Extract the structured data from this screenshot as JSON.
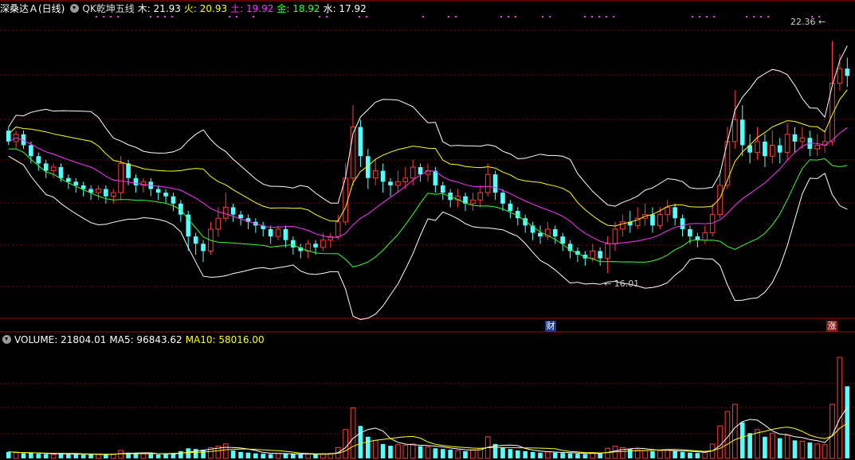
{
  "main_header": {
    "title": "深桑达Ａ(日线)",
    "indicator": "QK乾坤五线",
    "mu": "木: 21.93",
    "huo": "火: 20.93",
    "tu": "土: 19.92",
    "jin": "金: 18.92",
    "shui": "水: 17.92"
  },
  "volume_header": {
    "volume": "VOLUME: 21804.01",
    "ma5": "MA5: 96843.62",
    "ma10": "MA10: 58016.00"
  },
  "annotations": {
    "high_label": "22.36",
    "low_label": "16.01",
    "tag_cai": "财",
    "tag_zhang": "涨"
  },
  "colors": {
    "up": "#ff3b3b",
    "down": "#54ffff",
    "mu_line": "#ffffff",
    "huo_line": "#ffff00",
    "tu_line": "#ff33ff",
    "jin_line": "#33ff33",
    "shui_line": "#ffffff",
    "grid": "#8a0000"
  },
  "chart_data": {
    "type": "candlestick",
    "price_range": [
      14.8,
      23.0
    ],
    "volume_range": [
      0,
      300000
    ],
    "high": 22.36,
    "low": 16.01,
    "candles": [
      [
        19.9,
        19.6,
        20.0,
        19.5
      ],
      [
        19.6,
        19.8,
        19.9,
        19.4
      ],
      [
        19.8,
        19.5,
        19.9,
        19.4
      ],
      [
        19.5,
        19.2,
        19.6,
        19.0
      ],
      [
        19.2,
        19.0,
        19.3,
        18.8
      ],
      [
        19.0,
        18.8,
        19.1,
        18.6
      ],
      [
        18.8,
        18.9,
        19.0,
        18.6
      ],
      [
        18.9,
        18.6,
        19.0,
        18.5
      ],
      [
        18.6,
        18.5,
        18.7,
        18.3
      ],
      [
        18.5,
        18.4,
        18.6,
        18.2
      ],
      [
        18.4,
        18.3,
        18.5,
        18.1
      ],
      [
        18.3,
        18.2,
        18.4,
        18.0
      ],
      [
        18.2,
        18.3,
        18.4,
        18.0
      ],
      [
        18.3,
        18.1,
        18.4,
        17.9
      ],
      [
        18.1,
        18.2,
        18.3,
        17.9
      ],
      [
        18.2,
        19.0,
        19.2,
        18.0
      ],
      [
        19.0,
        18.6,
        19.1,
        18.4
      ],
      [
        18.6,
        18.4,
        18.7,
        18.2
      ],
      [
        18.4,
        18.5,
        18.6,
        18.2
      ],
      [
        18.5,
        18.3,
        18.6,
        18.1
      ],
      [
        18.3,
        18.2,
        18.4,
        18.0
      ],
      [
        18.2,
        18.1,
        18.3,
        17.9
      ],
      [
        18.1,
        17.9,
        18.2,
        17.7
      ],
      [
        17.9,
        17.6,
        18.0,
        17.4
      ],
      [
        17.6,
        17.0,
        17.7,
        16.6
      ],
      [
        17.0,
        16.8,
        17.1,
        16.5
      ],
      [
        16.8,
        16.6,
        16.9,
        16.3
      ],
      [
        16.6,
        17.2,
        17.4,
        16.5
      ],
      [
        17.2,
        17.5,
        17.8,
        17.0
      ],
      [
        17.5,
        17.8,
        18.2,
        17.4
      ],
      [
        17.8,
        17.6,
        17.9,
        17.4
      ],
      [
        17.6,
        17.5,
        17.7,
        17.3
      ],
      [
        17.5,
        17.4,
        17.6,
        17.2
      ],
      [
        17.4,
        17.3,
        17.5,
        17.1
      ],
      [
        17.3,
        17.2,
        17.4,
        17.0
      ],
      [
        17.2,
        17.0,
        17.3,
        16.8
      ],
      [
        17.0,
        17.2,
        17.3,
        16.9
      ],
      [
        17.2,
        16.9,
        17.3,
        16.7
      ],
      [
        16.9,
        16.7,
        17.0,
        16.5
      ],
      [
        16.7,
        16.6,
        16.8,
        16.4
      ],
      [
        16.6,
        16.8,
        16.9,
        16.4
      ],
      [
        16.8,
        16.7,
        16.9,
        16.5
      ],
      [
        16.7,
        16.9,
        17.1,
        16.6
      ],
      [
        16.9,
        17.0,
        17.1,
        16.7
      ],
      [
        17.0,
        17.4,
        17.6,
        16.9
      ],
      [
        17.4,
        18.6,
        19.0,
        17.3
      ],
      [
        18.6,
        20.0,
        20.6,
        18.4
      ],
      [
        20.0,
        19.2,
        20.2,
        18.9
      ],
      [
        19.2,
        18.6,
        19.4,
        18.3
      ],
      [
        18.6,
        18.8,
        19.1,
        18.4
      ],
      [
        18.8,
        18.5,
        19.0,
        18.2
      ],
      [
        18.5,
        18.4,
        18.6,
        18.1
      ],
      [
        18.4,
        18.5,
        18.8,
        18.2
      ],
      [
        18.5,
        18.6,
        18.9,
        18.3
      ],
      [
        18.6,
        18.9,
        19.1,
        18.4
      ],
      [
        18.9,
        18.7,
        19.0,
        18.5
      ],
      [
        18.7,
        18.8,
        19.0,
        18.5
      ],
      [
        18.8,
        18.4,
        18.9,
        18.2
      ],
      [
        18.4,
        18.2,
        18.5,
        18.0
      ],
      [
        18.2,
        18.0,
        18.3,
        17.8
      ],
      [
        18.0,
        18.1,
        18.3,
        17.8
      ],
      [
        18.1,
        17.9,
        18.2,
        17.7
      ],
      [
        17.9,
        18.0,
        18.2,
        17.7
      ],
      [
        18.0,
        18.2,
        18.4,
        17.8
      ],
      [
        18.2,
        18.7,
        19.0,
        18.1
      ],
      [
        18.7,
        18.2,
        18.8,
        18.0
      ],
      [
        18.2,
        17.9,
        18.3,
        17.7
      ],
      [
        17.9,
        17.7,
        18.0,
        17.5
      ],
      [
        17.7,
        17.5,
        17.8,
        17.3
      ],
      [
        17.5,
        17.3,
        17.6,
        17.1
      ],
      [
        17.3,
        17.1,
        17.4,
        16.9
      ],
      [
        17.1,
        17.0,
        17.3,
        16.8
      ],
      [
        17.0,
        17.2,
        17.4,
        16.9
      ],
      [
        17.2,
        17.0,
        17.3,
        16.8
      ],
      [
        17.0,
        16.8,
        17.1,
        16.6
      ],
      [
        16.8,
        16.6,
        16.9,
        16.4
      ],
      [
        16.6,
        16.5,
        16.7,
        16.3
      ],
      [
        16.5,
        16.4,
        16.6,
        16.2
      ],
      [
        16.4,
        16.6,
        16.8,
        16.3
      ],
      [
        16.6,
        16.4,
        16.7,
        16.2
      ],
      [
        16.4,
        16.8,
        17.0,
        16.0
      ],
      [
        16.8,
        17.2,
        17.4,
        16.6
      ],
      [
        17.2,
        17.4,
        17.6,
        17.0
      ],
      [
        17.4,
        17.3,
        17.7,
        17.1
      ],
      [
        17.3,
        17.5,
        17.8,
        17.2
      ],
      [
        17.5,
        17.6,
        17.9,
        17.3
      ],
      [
        17.6,
        17.3,
        17.8,
        17.1
      ],
      [
        17.3,
        17.6,
        17.8,
        17.2
      ],
      [
        17.6,
        17.8,
        18.0,
        17.4
      ],
      [
        17.8,
        17.5,
        17.9,
        17.3
      ],
      [
        17.5,
        17.2,
        17.6,
        17.0
      ],
      [
        17.2,
        17.0,
        17.3,
        16.8
      ],
      [
        17.0,
        16.9,
        17.1,
        16.7
      ],
      [
        16.9,
        17.1,
        17.3,
        16.8
      ],
      [
        17.1,
        17.6,
        17.9,
        17.0
      ],
      [
        17.6,
        18.4,
        18.8,
        17.5
      ],
      [
        18.4,
        19.6,
        20.0,
        18.3
      ],
      [
        19.6,
        20.2,
        21.0,
        19.4
      ],
      [
        20.2,
        19.5,
        20.6,
        19.2
      ],
      [
        19.5,
        19.3,
        19.8,
        19.0
      ],
      [
        19.3,
        19.6,
        20.0,
        19.1
      ],
      [
        19.6,
        19.2,
        19.8,
        18.9
      ],
      [
        19.2,
        19.5,
        19.9,
        19.0
      ],
      [
        19.5,
        19.3,
        19.7,
        19.0
      ],
      [
        19.3,
        19.8,
        20.1,
        19.1
      ],
      [
        19.8,
        19.6,
        20.0,
        19.3
      ],
      [
        19.6,
        19.7,
        20.0,
        19.4
      ],
      [
        19.7,
        19.4,
        19.9,
        19.2
      ],
      [
        19.4,
        19.5,
        19.8,
        19.2
      ],
      [
        19.5,
        19.6,
        19.9,
        19.3
      ],
      [
        19.6,
        21.2,
        22.36,
        19.5
      ],
      [
        21.2,
        21.6,
        22.0,
        21.0
      ],
      [
        21.6,
        21.4,
        21.9,
        21.1
      ]
    ],
    "volumes": [
      18000,
      16000,
      14000,
      15000,
      13000,
      12000,
      11000,
      14000,
      12000,
      11000,
      10000,
      12000,
      11000,
      10000,
      12000,
      22000,
      16000,
      14000,
      13000,
      12000,
      11000,
      12000,
      15000,
      20000,
      28000,
      26000,
      24000,
      30000,
      34000,
      40000,
      22000,
      18000,
      16000,
      14000,
      13000,
      12000,
      14000,
      13000,
      12000,
      11000,
      12000,
      11000,
      13000,
      14000,
      30000,
      80000,
      140000,
      90000,
      60000,
      50000,
      40000,
      35000,
      38000,
      36000,
      40000,
      34000,
      32000,
      28000,
      26000,
      24000,
      22000,
      20000,
      24000,
      28000,
      60000,
      40000,
      30000,
      26000,
      22000,
      20000,
      18000,
      16000,
      18000,
      16000,
      15000,
      14000,
      13000,
      12000,
      16000,
      14000,
      28000,
      34000,
      30000,
      26000,
      24000,
      22000,
      20000,
      22000,
      24000,
      20000,
      18000,
      16000,
      15000,
      16000,
      40000,
      90000,
      130000,
      150000,
      100000,
      70000,
      80000,
      60000,
      70000,
      56000,
      64000,
      50000,
      48000,
      44000,
      40000,
      38000,
      150000,
      280000,
      200000
    ]
  }
}
